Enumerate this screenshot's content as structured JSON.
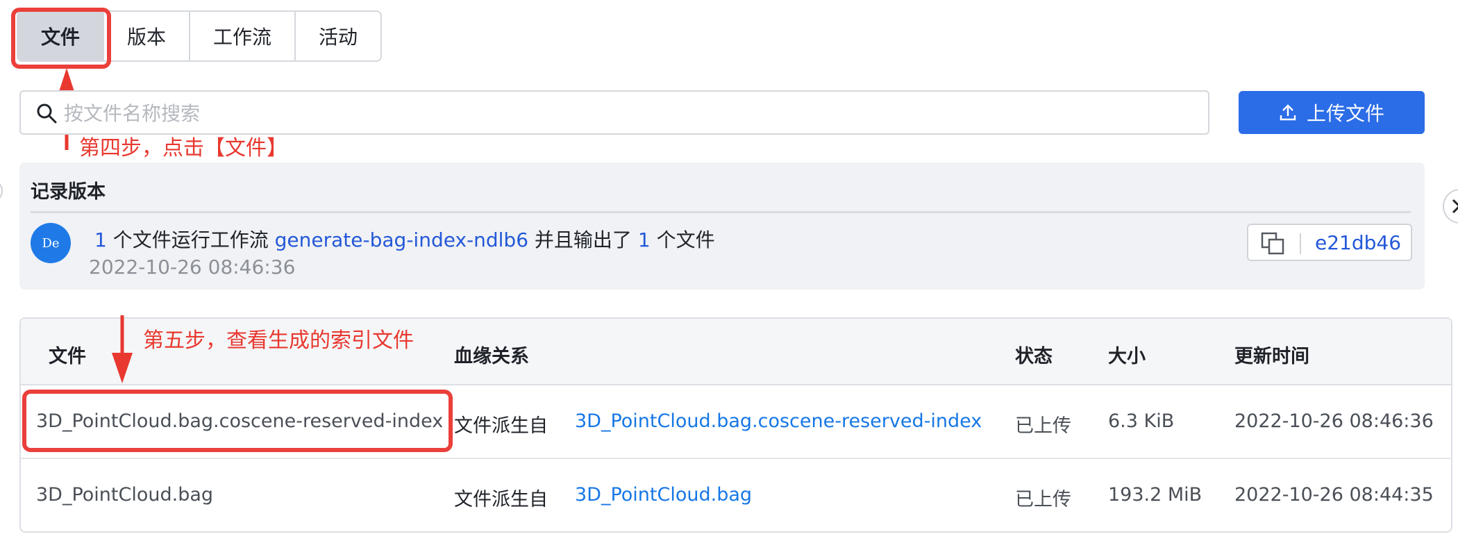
{
  "tabs": [
    {
      "label": "文件",
      "active": true
    },
    {
      "label": "版本",
      "active": false
    },
    {
      "label": "工作流",
      "active": false
    },
    {
      "label": "活动",
      "active": false
    }
  ],
  "search": {
    "placeholder": "按文件名称搜索",
    "icon": "search-icon"
  },
  "upload_button": {
    "label": "上传文件",
    "icon": "upload-icon"
  },
  "annotations": {
    "step4": "第四步，点击【文件】",
    "step5": "第五步，查看生成的索引文件",
    "color": "#e8382f"
  },
  "version_panel": {
    "title": "记录版本",
    "avatar": "De",
    "count_in": "1",
    "text_a": "个文件运行工作流",
    "workflow": "generate-bag-index-ndlb6",
    "text_b": "并且输出了",
    "count_out": "1",
    "text_c": "个文件",
    "timestamp": "2022-10-26 08:46:36",
    "hash": "e21db46"
  },
  "table": {
    "headers": {
      "file": "文件",
      "lineage": "血缘关系",
      "status": "状态",
      "size": "大小",
      "updated": "更新时间"
    },
    "rows": [
      {
        "file": "3D_PointCloud.bag.coscene-reserved-index",
        "lineage_prefix": "文件派生自",
        "lineage_link": "3D_PointCloud.bag.coscene-reserved-index",
        "status": "已上传",
        "size": "6.3 KiB",
        "updated": "2022-10-26 08:46:36"
      },
      {
        "file": "3D_PointCloud.bag",
        "lineage_prefix": "文件派生自",
        "lineage_link": "3D_PointCloud.bag",
        "status": "已上传",
        "size": "193.2 MiB",
        "updated": "2022-10-26 08:44:35"
      }
    ]
  },
  "colors": {
    "primary": "#2b6ce7",
    "link": "#1677e6",
    "accent_text": "#2458d8",
    "annotation": "#ea3f3a"
  }
}
